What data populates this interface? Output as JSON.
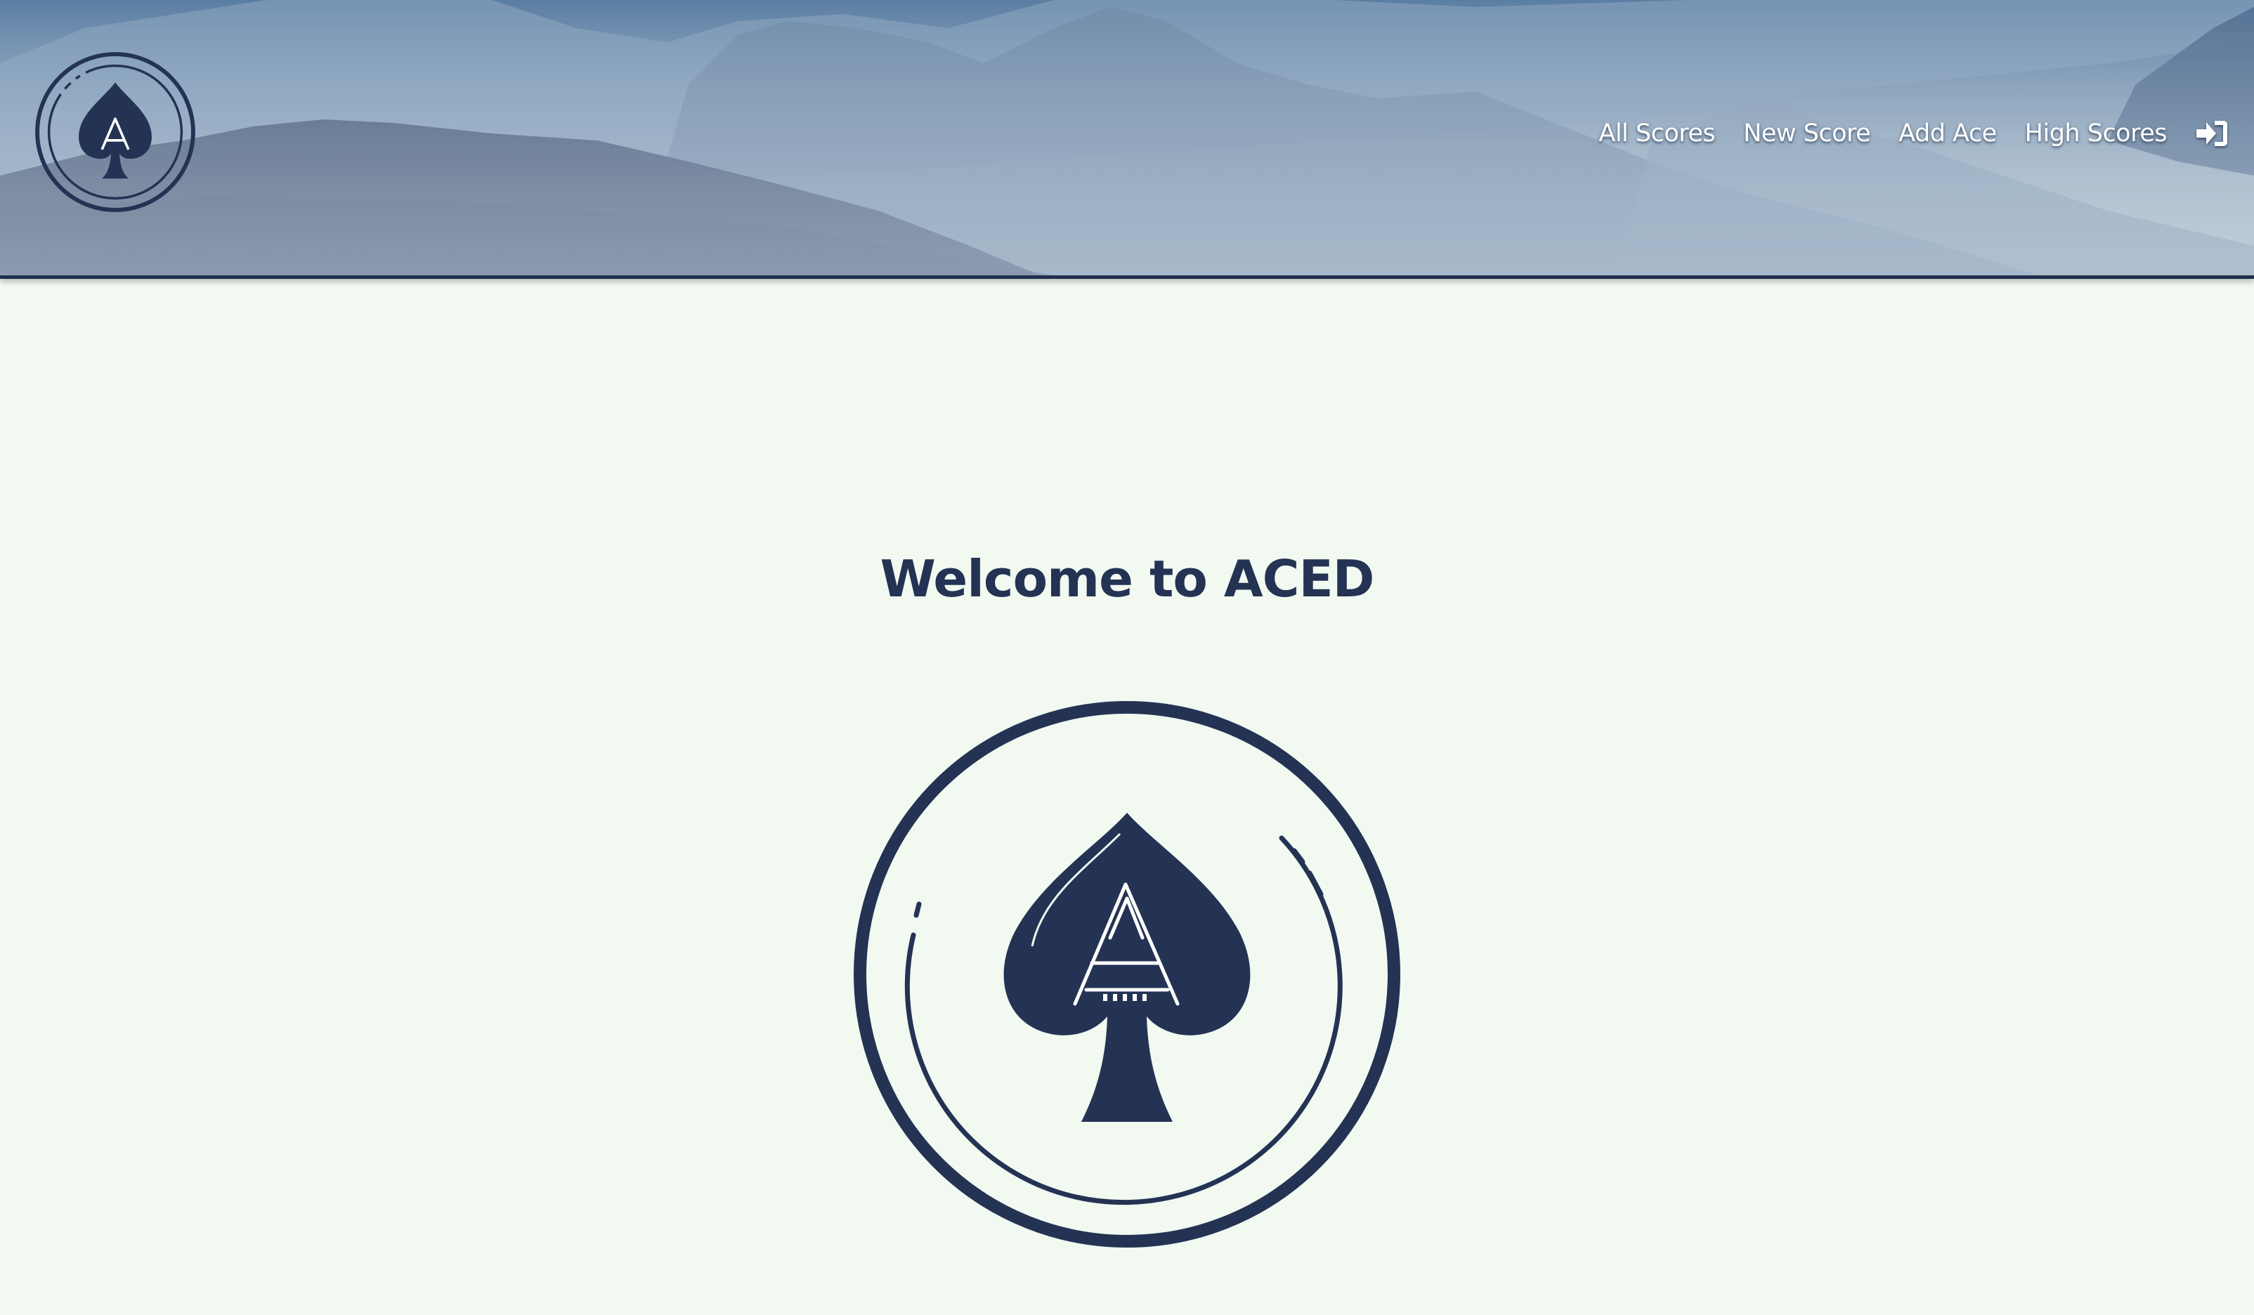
{
  "header": {
    "logo_icon": "ace-of-spades-logo-icon",
    "nav": {
      "all_scores": "All Scores",
      "new_score": "New Score",
      "add_ace": "Add Ace",
      "high_scores": "High Scores",
      "login_icon": "sign-in-icon"
    }
  },
  "main": {
    "title": "Welcome to ACED",
    "logo_icon": "ace-of-spades-logo-icon"
  },
  "colors": {
    "navy": "#243354",
    "page_background": "#f1f9f0"
  }
}
